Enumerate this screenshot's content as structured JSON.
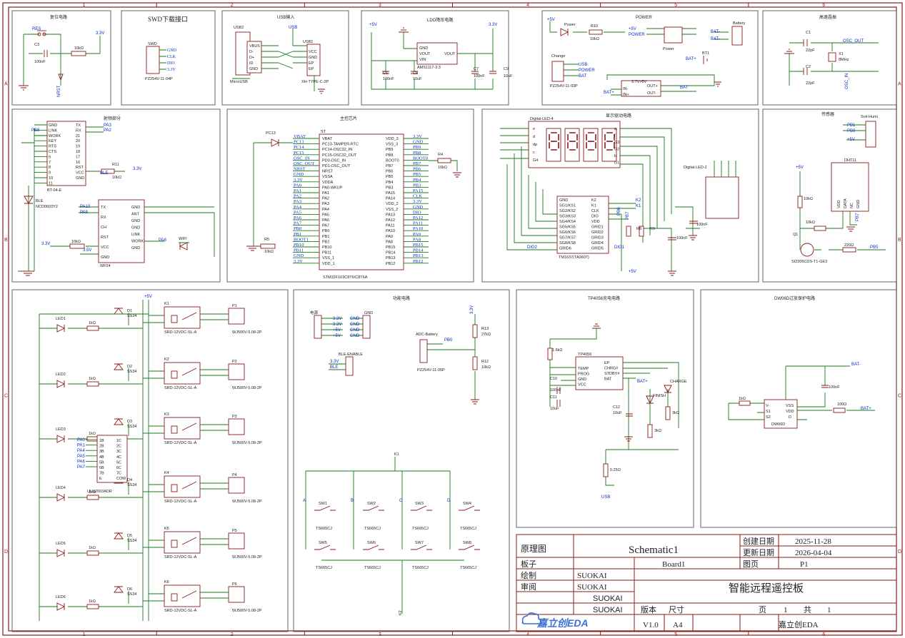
{
  "ruler": {
    "top": [
      "1",
      "2",
      "3",
      "4",
      "5",
      "6"
    ],
    "side": [
      "A",
      "B",
      "C",
      "D"
    ]
  },
  "sections": {
    "reset": {
      "title": "复位电路",
      "net_rst": "RES",
      "net_33": "3.3V",
      "c3": "C3",
      "c3v": "100nF",
      "r": "10kΩ",
      "nrst": "NRST"
    },
    "swd": {
      "title": "SWD下载接口",
      "conn": "SWD",
      "conn_part": "PZ254V-11-04P",
      "pins": [
        "GND",
        "CLK",
        "DIO",
        "3.3V"
      ]
    },
    "usb": {
      "title": "USB输入",
      "usb2": "USB2",
      "usb1": "USB1",
      "usb_net": "USB",
      "pins": [
        "VBUS",
        "D-",
        "D+",
        "ID",
        "GND"
      ],
      "pins2": [
        "VCC",
        "GND",
        "EP",
        "EP"
      ],
      "part1": "MicroUSB",
      "part2": "XH-TYPE-C-2P",
      "sh": [
        "SH3",
        "SH4",
        "SH2",
        "SH1"
      ]
    },
    "ldo": {
      "title": "LDO降压电路",
      "in": "+5V",
      "out": "3.3V",
      "part": "AMS1117-3.3",
      "pins": [
        "GND",
        "VOUT",
        "VIN",
        "VOUT"
      ],
      "c6": "C6",
      "c6v": "100nF",
      "c8": "C8",
      "c8v": "10uF",
      "c7": "C7",
      "c7v": "100nF",
      "c9": "C9",
      "c9v": "10uF"
    },
    "power": {
      "title": "POWER",
      "power": "Power",
      "r10": "R10",
      "r10v": "10kΩ",
      "p5": "+5V",
      "pw": "POWER",
      "pwsw": "Power",
      "batm": "BAT-",
      "bat": "Battery",
      "batp": "BAT+",
      "bt1": "BT1",
      "change": "Change",
      "usb": "USB",
      "pwr2": "POWER",
      "bat2": "BAT",
      "charge_part": "PZ254V-11-03P",
      "conv": "3.7V>5V",
      "in_p": "IN+",
      "in_m": "IN-",
      "out_p": "OUT+",
      "out_m": "OUT-",
      "bat3": "BAT",
      "batp2": "BAT+"
    },
    "osc": {
      "title": "高速晶振",
      "c1": "C1",
      "c1v": "22pF",
      "c2": "C2",
      "c2v": "22pF",
      "x1": "X1",
      "x1v": "8MHz",
      "osc_out": "OSC_OUT",
      "osc_in": "OSC_IN"
    },
    "rf": {
      "title": "射频部分",
      "pins_l": [
        "GND",
        "LINK",
        "WORK",
        "KEY",
        "RTS",
        "CTS",
        "6",
        "7",
        "8",
        "9",
        "10",
        "11"
      ],
      "pins_r": [
        "TX",
        "RX",
        "21",
        "20",
        "19",
        "18",
        "17",
        "16",
        "RST",
        "VCC",
        "GND"
      ],
      "net_pa3": "PA3",
      "net_pa2": "PA2",
      "net_pb8": "PB8",
      "part": "BT-04-E",
      "r11": "R11",
      "r11v": "10kΩ",
      "ble": "BLE",
      "ble_part": "NCD0603Y2",
      "v33": "3.3V",
      "wifi_l": [
        "TX",
        "RX",
        "CH",
        "RST",
        "VCC",
        "GND"
      ],
      "wifi_r": [
        "GND",
        "ANT",
        "GND",
        "GND",
        "LINK",
        "WORK",
        "GND"
      ],
      "pa10": "PA10",
      "pa9": "PA9",
      "wf": "WF24",
      "wifi": "WIFI",
      "pa8": "PA8",
      "r10b": "10kΩ",
      "v33b": "3.3V",
      "v35": "3.5V"
    },
    "mcu": {
      "title": "主控芯片",
      "chip": "ST",
      "part": "STM32F103C8T6/C8T6A",
      "pc13": "PC13",
      "r5": "R5",
      "r5v": "10kΩ",
      "r4": "R4",
      "r4v": "10kΩ",
      "left_nets": [
        "VBAT",
        "PC13",
        "PC14",
        "PC15",
        "OSC_IN",
        "OSC_OUT",
        "NRST",
        "GND",
        "3.3V",
        "PA0",
        "PA1",
        "PA2",
        "PA3",
        "PA4",
        "PA5",
        "PA6",
        "PA7",
        "PB0",
        "PB1",
        "BOOT1",
        "PB10",
        "PB11",
        "GND",
        "3.3V"
      ],
      "left_pins": [
        "VBAT",
        "PC13-TAMPER-RTC",
        "PC14-OSC32_IN",
        "PC15-OSC32_OUT",
        "PD0-OSC_IN",
        "PD1-OSC_OUT",
        "NRST",
        "VSSA",
        "VDDA",
        "PA0-WKUP",
        "PA1",
        "PA2",
        "PA3",
        "PA4",
        "PA5",
        "PA6",
        "PA7",
        "PB0",
        "PB1",
        "PB2",
        "PB10",
        "PB11",
        "VSS_1",
        "VDD_1"
      ],
      "right_pins": [
        "VDD_3",
        "VSS_3",
        "PB9",
        "PB8",
        "BOOT0",
        "PB7",
        "PB6",
        "PB5",
        "PB4",
        "PB3",
        "PA15",
        "PA14",
        "VDD_2",
        "VSS_2",
        "PA13",
        "PA12",
        "PA11",
        "PA10",
        "PA9",
        "PA8",
        "PB15",
        "PB14",
        "PB13",
        "PB12"
      ],
      "right_nets": [
        "3.3V",
        "GND",
        "PB9",
        "PB8",
        "BOOT0",
        "PB7",
        "PB6",
        "PB5",
        "PB4",
        "PB3",
        "PA15",
        "CLK",
        "3.3V",
        "GND",
        "DIO",
        "PA12",
        "PA11",
        "PA10",
        "PA9",
        "PA8",
        "PB15",
        "PB14",
        "PB13",
        "PB12"
      ]
    },
    "disp": {
      "title": "显示驱动电路",
      "led4": "Digital-LED-4",
      "led2": "Digital-LED-2",
      "drv": "TM1637(TA0607)",
      "drv_pins_l": [
        "GND",
        "SG1/KS1",
        "SG2/KS2",
        "SG3/KS3",
        "SG4/KS4",
        "SG5/KS5",
        "SG6/KS6",
        "SG7/KS7",
        "SG8/KS8",
        "GRID6"
      ],
      "drv_pins_r": [
        "K2",
        "K1",
        "CLK",
        "DIO",
        "VDD",
        "GRID1",
        "GRID2",
        "GRID3",
        "GRID4",
        "GRID5"
      ],
      "k2": "K2",
      "k1": "K1",
      "pb6": "PB6",
      "pb7": "PB7",
      "dig": "DIG2",
      "dig1": "DIG1",
      "c100": "100nF",
      "c100b": "100nF",
      "r8": "R8",
      "r9": "R9",
      "v5": "+5V",
      "seg": [
        "e",
        "d",
        "dp",
        "c",
        "G4",
        "a",
        "f",
        "G3",
        "G2",
        "b",
        "G1"
      ]
    },
    "sens": {
      "title": "传感器",
      "soil": "Soil-Humi",
      "pb1": "PB1",
      "pb0": "PB0",
      "v5": "+5V",
      "dht": "DHT11",
      "dht_pins": [
        "VDD",
        "DATA",
        "NC",
        "GND"
      ],
      "v5b": "+5V",
      "r": "10kΩ",
      "q1": "Q1",
      "q_part": "SI2305CDS-T1-GE3",
      "r220": "220Ω",
      "pb5": "PB5",
      "r10k": "10kΩ",
      "pb2": "PB7"
    },
    "relay": {
      "title": "",
      "v5": "+5V",
      "leds": [
        "LED1",
        "LED2",
        "LED3",
        "LED4",
        "LED5",
        "LED6"
      ],
      "diodes": [
        "D1",
        "D2",
        "D3",
        "D4",
        "D5",
        "D6"
      ],
      "dpart": "SS34",
      "r": "1kΩ",
      "relays": [
        "K1",
        "K2",
        "K3",
        "K4",
        "K5",
        "K6"
      ],
      "rpart": "SRD-12VDC-SL-A",
      "conns": [
        "P1",
        "P2",
        "P3",
        "P4",
        "P5",
        "P6"
      ],
      "cpart": "WJ500V-5.08-2P",
      "uln": "ULN2003ADR",
      "uln_l": [
        "1B",
        "2B",
        "3B",
        "4B",
        "5B",
        "6B",
        "7B",
        "E"
      ],
      "uln_r": [
        "1C",
        "2C",
        "3C",
        "4C",
        "5C",
        "6C",
        "7C",
        "COM"
      ],
      "pa_nets": [
        "PA0",
        "PA1",
        "PA4",
        "PA5",
        "PA6",
        "PA7"
      ]
    },
    "func": {
      "title": "功能电路",
      "power": "电源",
      "gnd": "GND",
      "v33": "3.3V",
      "v5": "+5V",
      "ble_en": "BLE-ENABLE",
      "ble": "BLE",
      "adc": "ADC-Battery",
      "pb0": "PB0",
      "adc_part": "PZ254V-11-05P",
      "r13": "R13",
      "r13v": "27kΩ",
      "r12": "R12",
      "r12v": "10kΩ",
      "v33r": "3.3V",
      "k1": "K1",
      "k2": "K2",
      "sws": [
        "SW1",
        "SW2",
        "SW3",
        "SW4",
        "SW5",
        "SW6",
        "SW7",
        "SW8"
      ],
      "swpart": "TS665CJ",
      "cols": [
        "A",
        "B",
        "C",
        "D"
      ]
    },
    "charge": {
      "title": "TP4056充电电路",
      "tp": "TP4056",
      "pins_l": [
        "TEMP",
        "PROG",
        "GND",
        "VCC"
      ],
      "pins_r": [
        "EP",
        "CHRG#",
        "STDBY#",
        "BAT"
      ],
      "c10": "C10",
      "c10v": "100nF",
      "c11": "C11",
      "c11v": "10uF",
      "c12": "C12",
      "c12v": "10uF",
      "r16k": "1.6kΩ",
      "batp": "BAT+",
      "finish": "FINISH",
      "charge": "CHARGE",
      "r3k": "3kΩ",
      "r3k2": "3kΩ",
      "r025": "0.25Ω",
      "usb": "USB"
    },
    "prot": {
      "title": "DW06D过放保护电路",
      "batm": "BAT-",
      "batp": "BAT+",
      "c100": "100nF",
      "r1k": "1kΩ",
      "r100": "100Ω",
      "part": "DW06D",
      "pins_l": [
        "V-",
        "S1",
        "S2"
      ],
      "pins_r": [
        "VSS",
        "VDD",
        "D"
      ]
    }
  },
  "titleblock": {
    "schematic_lbl": "原理图",
    "schematic": "Schematic1",
    "create_lbl": "创建日期",
    "create": "2025-11-28",
    "update_lbl": "更新日期",
    "update": "2026-04-04",
    "board_lbl": "板子",
    "board": "Board1",
    "page_lbl": "图页",
    "page": "P1",
    "draw_lbl": "绘制",
    "draw": "SUOKAI",
    "review_lbl": "审阅",
    "review": "SUOKAI",
    "title": "智能远程遥控板",
    "who1": "SUOKAI",
    "who2": "SUOKAI",
    "ver_lbl": "版本",
    "size_lbl": "尺寸",
    "pg_lbl": "页",
    "pg": "1",
    "tot_lbl": "共",
    "tot": "1",
    "ver": "V1.0",
    "size": "A4",
    "brand": "嘉立创EDA",
    "footer": "嘉立创EDA"
  },
  "colors": {
    "frame": "#8b1a1a",
    "wire": "#1a7a1a",
    "net": "#0a2ec4",
    "brand": "#3b6fd4"
  }
}
